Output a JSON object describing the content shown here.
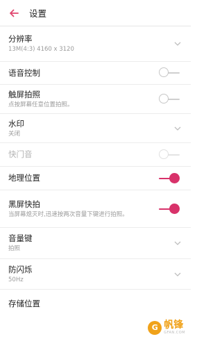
{
  "header": {
    "title": "设置"
  },
  "items": [
    {
      "label": "分辨率",
      "sub": "13M(4:3) 4160 x 3120",
      "control": "chevron"
    },
    {
      "label": "语音控制",
      "control": "toggle",
      "state": "off"
    },
    {
      "label": "触屏拍照",
      "sub": "点按屏幕任意位置拍照。",
      "control": "toggle",
      "state": "off"
    },
    {
      "label": "水印",
      "sub": "关闭",
      "control": "chevron"
    },
    {
      "label": "快门音",
      "control": "toggle",
      "state": "off",
      "disabled": true
    },
    {
      "label": "地理位置",
      "control": "toggle",
      "state": "on"
    },
    {
      "label": "黑屏快拍",
      "sub": "当屏幕熄灭时,迅速按两次音量下键进行拍照。",
      "control": "toggle",
      "state": "on"
    },
    {
      "label": "音量键",
      "sub": "拍照",
      "control": "chevron"
    },
    {
      "label": "防闪烁",
      "sub": "50Hz",
      "control": "chevron"
    },
    {
      "label": "存储位置",
      "control": "none"
    }
  ],
  "watermark": {
    "main": "帆锋",
    "sub": "GFAN.COM",
    "logo_char": "G"
  },
  "colors": {
    "accent": "#d8326a",
    "back_arrow": "#e0456e"
  }
}
